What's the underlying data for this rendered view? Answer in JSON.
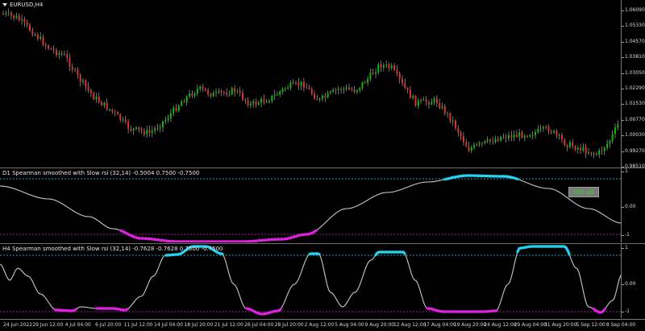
{
  "main": {
    "symbol_label": "EURUSD,H4",
    "y_labels": [
      "1.06090",
      "1.05330",
      "1.04570",
      "1.03810",
      "1.03050",
      "1.02290",
      "1.01530",
      "1.00770",
      "1.00030",
      "0.99270",
      "0.98510"
    ],
    "colors": {
      "bull": "#00c000",
      "bear": "#e03030",
      "wick": "#bbbbbb"
    }
  },
  "d1": {
    "title": "D1 Spearman smoothed with Slow rsi (32,14) -0.5004 0.7500 -0.7500",
    "y_labels": [
      "1",
      "0.00",
      "-1"
    ],
    "button_label": "SRC-off"
  },
  "h4": {
    "title": "H4 Spearman smoothed with Slow rsi (32,14) -0.7628 -0.7628 0.7500 -0.7500",
    "y_labels": [
      "1",
      "0.00",
      "-1"
    ]
  },
  "indicator": {
    "line_color": "#c8c8c8",
    "upper_color": "#23d2f0",
    "lower_color": "#e020e0"
  },
  "x_labels": [
    "24 Jun 2022",
    "29 Jun 12:00",
    "4 Jul 04:00",
    "6 Jul 20:00",
    "11 Jul 12:00",
    "14 Jul 04:00",
    "18 Jul 20:00",
    "21 Jul 12:00",
    "26 Jul 04:00",
    "28 Jul 20:00",
    "2 Aug 12:00",
    "5 Aug 04:00",
    "9 Aug 20:00",
    "12 Aug 12:00",
    "17 Aug 04:00",
    "19 Aug 20:00",
    "24 Aug 12:00",
    "29 Aug 04:00",
    "31 Aug 20:00",
    "5 Sep 12:00",
    "8 Sep 04:00"
  ]
}
